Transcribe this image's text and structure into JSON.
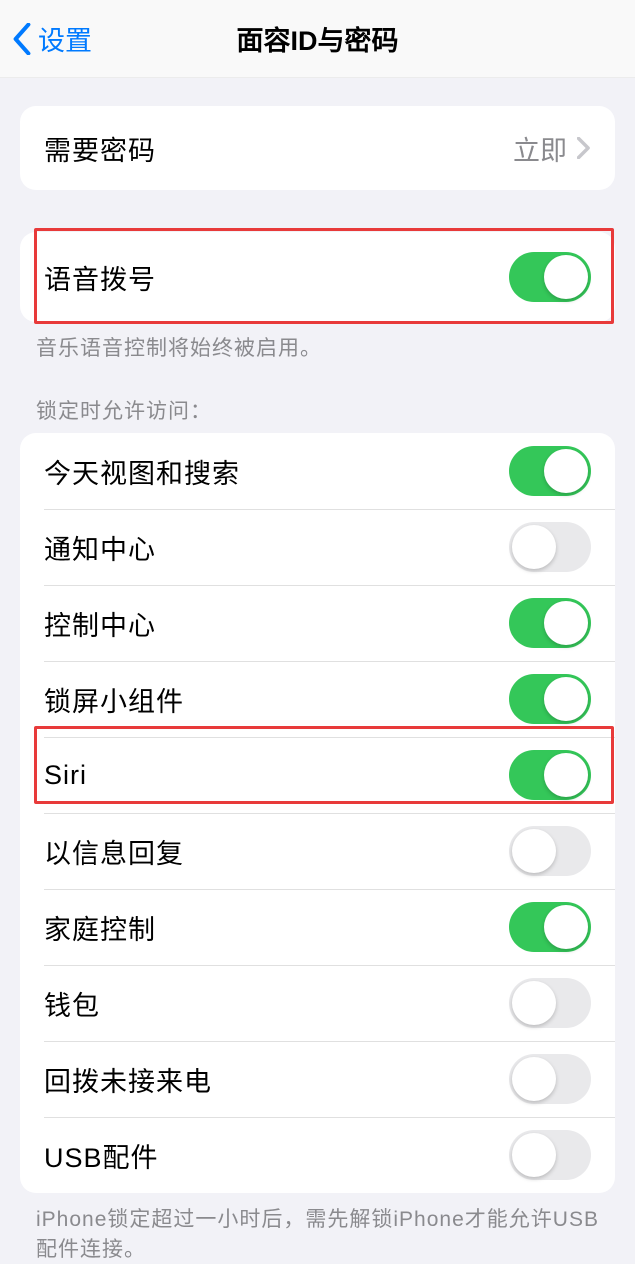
{
  "nav": {
    "back_label": "设置",
    "title": "面容ID与密码"
  },
  "passcode_group": {
    "require_passcode": {
      "label": "需要密码",
      "value": "立即"
    }
  },
  "voice_group": {
    "voice_dial": {
      "label": "语音拨号",
      "on": true
    },
    "footer": "音乐语音控制将始终被启用。"
  },
  "locked_access": {
    "header": "锁定时允许访问：",
    "items": [
      {
        "label": "今天视图和搜索",
        "on": true
      },
      {
        "label": "通知中心",
        "on": false
      },
      {
        "label": "控制中心",
        "on": true
      },
      {
        "label": "锁屏小组件",
        "on": true
      },
      {
        "label": "Siri",
        "on": true
      },
      {
        "label": "以信息回复",
        "on": false
      },
      {
        "label": "家庭控制",
        "on": true
      },
      {
        "label": "钱包",
        "on": false
      },
      {
        "label": "回拨未接来电",
        "on": false
      },
      {
        "label": "USB配件",
        "on": false
      }
    ],
    "footer": "iPhone锁定超过一小时后，需先解锁iPhone才能允许USB配件连接。"
  }
}
